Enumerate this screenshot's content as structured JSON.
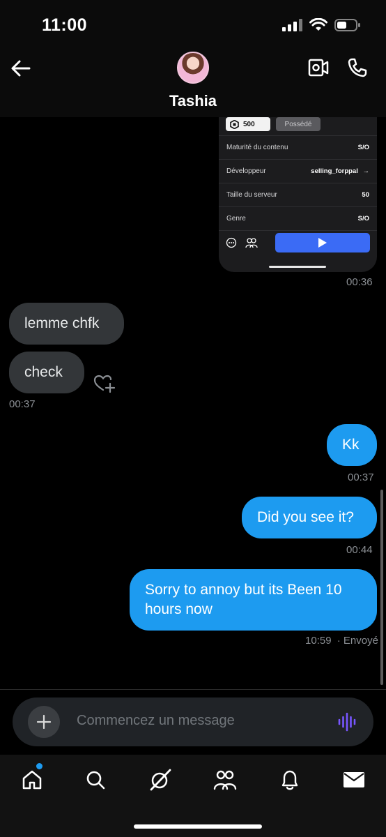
{
  "status_bar": {
    "time": "11:00"
  },
  "header": {
    "contact_name": "Tashia"
  },
  "shared_card": {
    "price": "500",
    "owned_label": "Possédé",
    "rows": [
      {
        "label": "Maturité du contenu",
        "value": "S/O"
      },
      {
        "label": "Développeur",
        "value": "selling_forppal",
        "arrow": "→"
      },
      {
        "label": "Taille du serveur",
        "value": "50"
      },
      {
        "label": "Genre",
        "value": "S/O"
      }
    ],
    "timestamp": "00:36"
  },
  "messages": [
    {
      "id": "m1",
      "direction": "in",
      "text": "lemme chfk"
    },
    {
      "id": "m2",
      "direction": "in",
      "text": "check",
      "timestamp": "00:37"
    },
    {
      "id": "m3",
      "direction": "out",
      "text": "Kk",
      "timestamp": "00:37"
    },
    {
      "id": "m4",
      "direction": "out",
      "text": "Did you see it?",
      "timestamp": "00:44"
    },
    {
      "id": "m5",
      "direction": "out",
      "text": "Sorry to annoy but its Been 10 hours now",
      "timestamp": "10:59",
      "status": "· Envoyé"
    }
  ],
  "composer": {
    "placeholder": "Commencez un message"
  },
  "colors": {
    "accent": "#1d9bf0",
    "incoming_bubble": "#333639",
    "voice_icon": "#7856ff",
    "play_button": "#3b6bf5"
  },
  "bottom_nav": {
    "items": [
      "home-icon",
      "search-icon",
      "grok-icon",
      "communities-icon",
      "notifications-icon",
      "messages-icon"
    ],
    "active": "messages-icon",
    "home_has_badge": true
  }
}
